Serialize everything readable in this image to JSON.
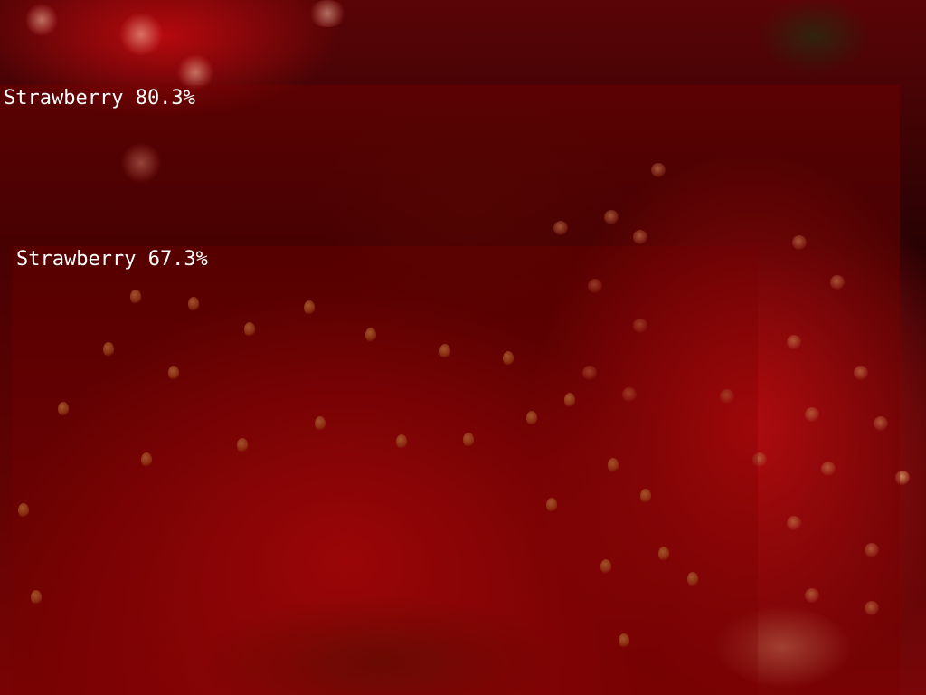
{
  "image": {
    "subject": "strawberry-closeup"
  },
  "detections": [
    {
      "label": "Strawberry 80.3%",
      "class": "Strawberry",
      "confidence_percent": 80.3
    },
    {
      "label": "Strawberry 67.3%",
      "class": "Strawberry",
      "confidence_percent": 67.3
    }
  ],
  "colors": {
    "box_fill": "#780000",
    "label_text": "#ffffff"
  }
}
